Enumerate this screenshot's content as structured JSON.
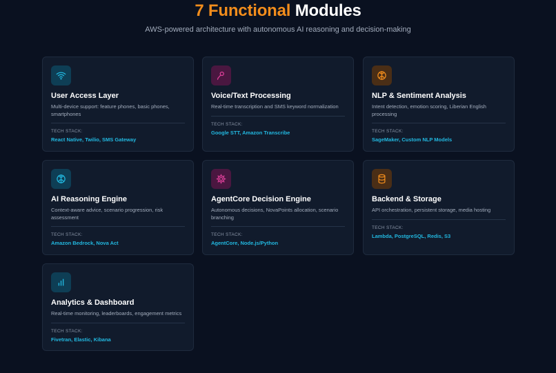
{
  "header": {
    "title_accent": "7 Functional",
    "title_rest": "Modules",
    "subtitle": "AWS-powered architecture with autonomous AI reasoning and decision-making"
  },
  "colors": {
    "accent": "#f28d1c",
    "tech": "#22b8e0",
    "background": "#0a1120",
    "card": "#111b2c"
  },
  "modules": [
    {
      "icon": "wifi-icon",
      "title": "User Access Layer",
      "description": "Multi-device support: feature phones, basic phones, smartphones",
      "stack_label": "TECH STACK:",
      "stack": "React Native, Twilio, SMS Gateway"
    },
    {
      "icon": "microphone-icon",
      "title": "Voice/Text Processing",
      "description": "Real-time transcription and SMS keyword normalization",
      "stack_label": "TECH STACK:",
      "stack": "Google STT, Amazon Transcribe"
    },
    {
      "icon": "brain-icon",
      "title": "NLP & Sentiment Analysis",
      "description": "Intent detection, emotion scoring, Liberian English processing",
      "stack_label": "TECH STACK:",
      "stack": "SageMaker, Custom NLP Models"
    },
    {
      "icon": "brain-icon",
      "title": "AI Reasoning Engine",
      "description": "Context-aware advice, scenario progression, risk assessment",
      "stack_label": "TECH STACK:",
      "stack": "Amazon Bedrock, Nova Act"
    },
    {
      "icon": "cog-icon",
      "title": "AgentCore Decision Engine",
      "description": "Autonomous decisions, NovaPoints allocation, scenario branching",
      "stack_label": "TECH STACK:",
      "stack": "AgentCore, Node.js/Python"
    },
    {
      "icon": "database-icon",
      "title": "Backend & Storage",
      "description": "API orchestration, persistent storage, media hosting",
      "stack_label": "TECH STACK:",
      "stack": "Lambda, PostgreSQL, Redis, S3"
    },
    {
      "icon": "bar-chart-icon",
      "title": "Analytics & Dashboard",
      "description": "Real-time monitoring, leaderboards, engagement metrics",
      "stack_label": "TECH STACK:",
      "stack": "Fivetran, Elastic, Kibana"
    }
  ]
}
